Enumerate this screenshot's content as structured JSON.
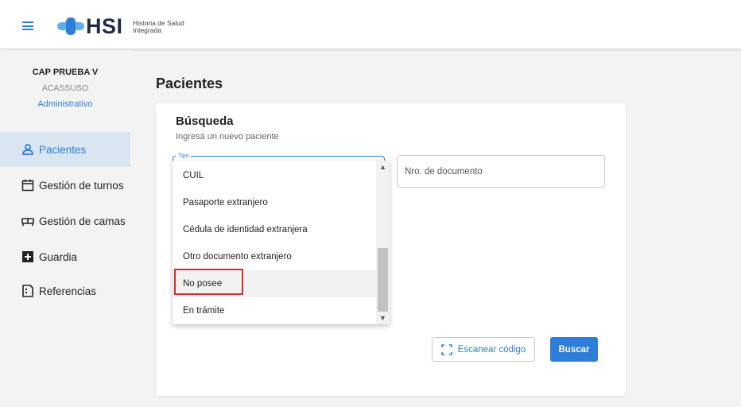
{
  "app": {
    "logo_text": "HSI",
    "logo_sub_line1": "Historia de Salud",
    "logo_sub_line2": "Integrada",
    "accent_color": "#2e7dd6"
  },
  "institution": {
    "name": "CAP PRUEBA V",
    "location": "ACASSUSO",
    "role": "Administrativo"
  },
  "sidebar": {
    "items": [
      {
        "label": "Pacientes",
        "icon": "person-icon",
        "active": true
      },
      {
        "label": "Gestión de turnos",
        "icon": "calendar-icon",
        "active": false
      },
      {
        "label": "Gestión de camas",
        "icon": "bed-icon",
        "active": false
      },
      {
        "label": "Guardia",
        "icon": "plus-square-icon",
        "active": false
      },
      {
        "label": "Referencias",
        "icon": "document-icon",
        "active": false
      }
    ]
  },
  "main": {
    "page_title": "Pacientes",
    "card_title": "Búsqueda",
    "card_subtitle": "Ingresá un nuevo paciente",
    "tipo_label": "Tipo",
    "doc_placeholder": "Nro. de documento",
    "dropdown_options": [
      "CUIL",
      "Pasaporte extranjero",
      "Cédula de identidad extranjera",
      "Otro documento extranjero",
      "No posee",
      "En trámite"
    ],
    "highlighted_option": "No posee",
    "scan_button": "Escanear código",
    "search_button": "Buscar"
  }
}
